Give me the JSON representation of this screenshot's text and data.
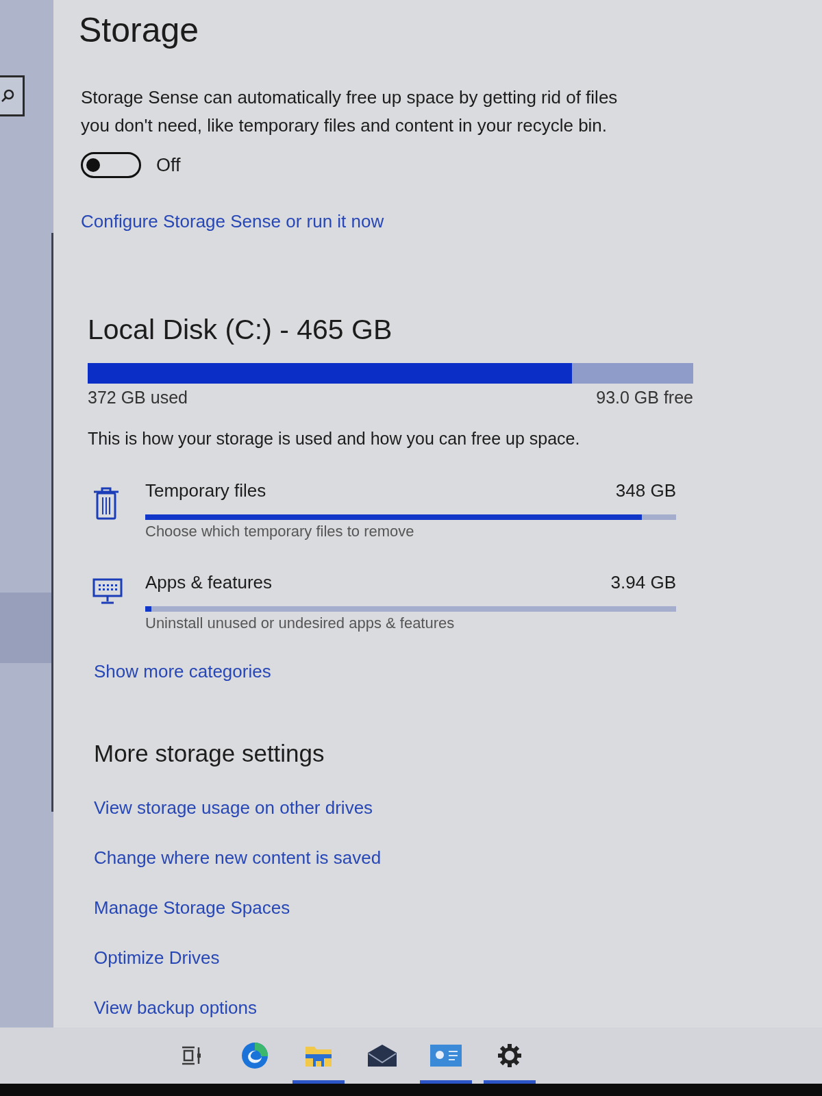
{
  "page": {
    "title": "Storage"
  },
  "storage_sense": {
    "description": "Storage Sense can automatically free up space by getting rid of files you don't need, like temporary files and content in your recycle bin.",
    "toggle": {
      "on": false,
      "label": "Off"
    },
    "link": "Configure Storage Sense or run it now"
  },
  "disk": {
    "title": "Local Disk (C:) - 465 GB",
    "level": 0.8,
    "used": "372 GB used",
    "free": "93.0 GB free",
    "description": "This is how your storage is used and how you can free up space."
  },
  "categories": [
    {
      "kind": "temp",
      "name": "Temporary files",
      "size": "348 GB",
      "level": 0.935,
      "hint": "Choose which temporary files to remove"
    },
    {
      "kind": "apps",
      "name": "Apps & features",
      "size": "3.94 GB",
      "level": 0.011,
      "hint": "Uninstall unused or undesired apps & features"
    }
  ],
  "show_more_link": "Show more categories",
  "more_settings": {
    "title": "More storage settings",
    "links": [
      "View storage usage on other drives",
      "Change where new content is saved",
      "Manage Storage Spaces",
      "Optimize Drives",
      "View backup options"
    ]
  },
  "taskbar": {
    "apps": [
      {
        "kind": "taskview",
        "running": false
      },
      {
        "kind": "browser",
        "running": false
      },
      {
        "kind": "folder",
        "running": true
      },
      {
        "kind": "mail",
        "running": false
      },
      {
        "kind": "card",
        "running": true
      },
      {
        "kind": "settings",
        "running": true
      }
    ]
  }
}
